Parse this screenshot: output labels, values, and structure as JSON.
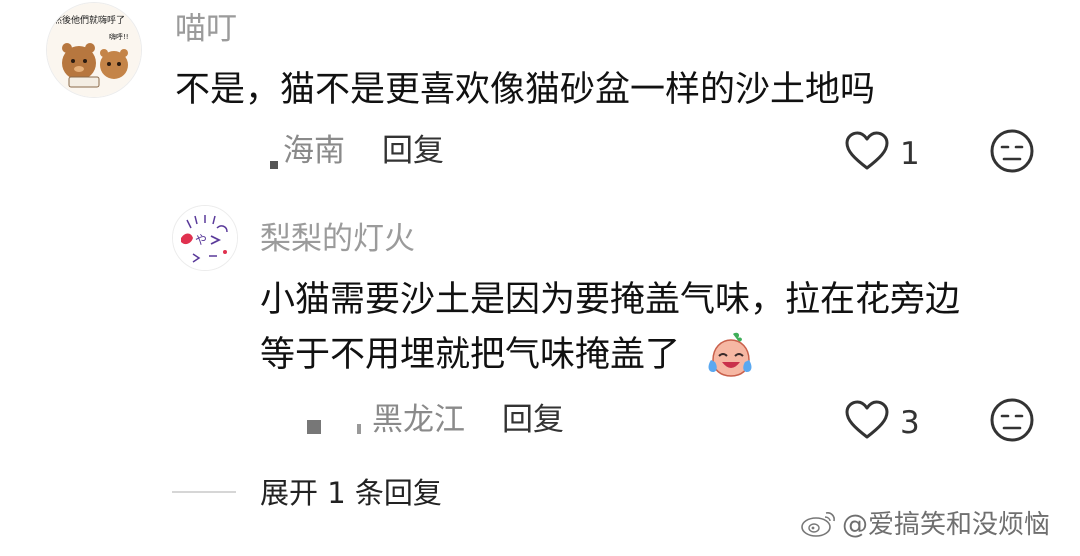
{
  "comments": [
    {
      "username": "喵叮",
      "avatar_caption": "然後他們就嗨呼了",
      "avatar_caption_small": "嗨呼!!",
      "text_lines": [
        "不是，猫不是更喜欢像猫砂盆一样的沙土地吗"
      ],
      "location": "海南",
      "reply_label": "回复",
      "likes": "1",
      "like_icon": "heart-outline-icon",
      "dislike_icon": "neutral-face-icon"
    },
    {
      "username": "梨梨的灯火",
      "text_lines": [
        "小猫需要沙土是因为要掩盖气味，拉在花旁边",
        "等于不用埋就把气味掩盖了"
      ],
      "inline_emoji": "crying-laughing-emoji-icon",
      "location": "黑龙江",
      "reply_label": "回复",
      "likes": "3",
      "like_icon": "heart-outline-icon",
      "dislike_icon": "neutral-face-icon"
    }
  ],
  "expand_replies": "展开 1 条回复",
  "watermark": "@爱搞笑和没烦恼",
  "watermark_icon": "weibo-logo-icon"
}
